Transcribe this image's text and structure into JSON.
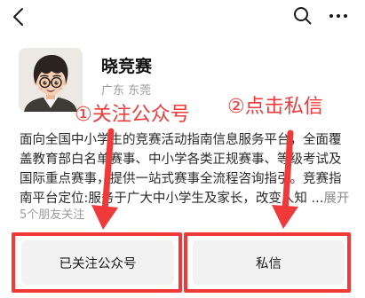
{
  "header": {
    "back_icon": "chevron-left-icon",
    "search_icon": "search-icon",
    "more_icon": "more-dots-icon"
  },
  "profile": {
    "name": "晓竞赛",
    "location": "广东 东莞",
    "description_lines": [
      "面向全国中小学生的竞赛活动指南信息服务平台，全面覆",
      "盖教育部白名单赛事、中小学各类正规赛事、等级考试及",
      "国际重点赛事，提供一站式赛事全流程咨询指引。竞赛指",
      "南平台定位:服务于广大中小学生及家长，改变人知 ..."
    ],
    "expand_label": "展开",
    "friends_following": "5个朋友关注"
  },
  "annotations": {
    "step1_label": "①关注公众号",
    "step2_label": "②点击私信",
    "color": "#f03a3a"
  },
  "actions": {
    "followed_label": "已关注公众号",
    "message_label": "私信"
  },
  "colors": {
    "button_background": "#f2f2f2",
    "text_primary": "#1a1a1a",
    "text_secondary": "#9b9b9b"
  }
}
